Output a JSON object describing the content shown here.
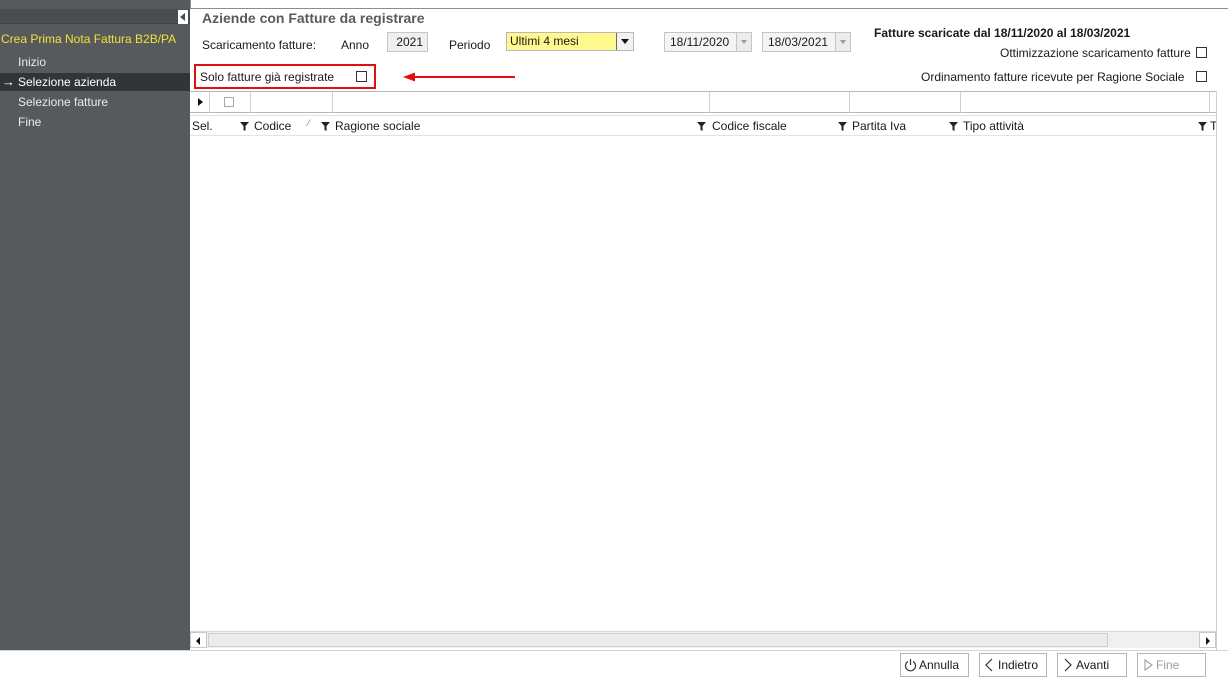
{
  "sidebar": {
    "title": "Crea Prima Nota Fattura B2B/PA",
    "items": [
      {
        "label": "Inizio",
        "active": false
      },
      {
        "label": "Selezione azienda",
        "active": true
      },
      {
        "label": "Selezione fatture",
        "active": false
      },
      {
        "label": "Fine",
        "active": false
      }
    ]
  },
  "header": {
    "title": "Aziende con Fatture da registrare",
    "download_label": "Scaricamento fatture:",
    "anno_label": "Anno",
    "anno_value": "2021",
    "periodo_label": "Periodo",
    "periodo_value": "Ultimi 4 mesi",
    "date_from": "18/11/2020",
    "date_to": "18/03/2021",
    "note": "Fatture scaricate dal 18/11/2020 al 18/03/2021",
    "opt_download": "Ottimizzazione scaricamento fatture",
    "opt_sort": "Ordinamento fatture ricevute per Ragione Sociale",
    "solo_registrate": "Solo fatture già registrate"
  },
  "grid": {
    "columns": [
      "Sel.",
      "Codice",
      "Ragione sociale",
      "Codice fiscale",
      "Partita Iva",
      "Tipo attività",
      "T"
    ],
    "rows": []
  },
  "footer": {
    "annulla": "Annulla",
    "indietro": "Indietro",
    "avanti": "Avanti",
    "fine": "Fine"
  },
  "colors": {
    "sidebar_bg": "#575a5c",
    "sidebar_title": "#f2e13a",
    "periodo_bg": "#fff88c",
    "highlight": "#e01010"
  }
}
